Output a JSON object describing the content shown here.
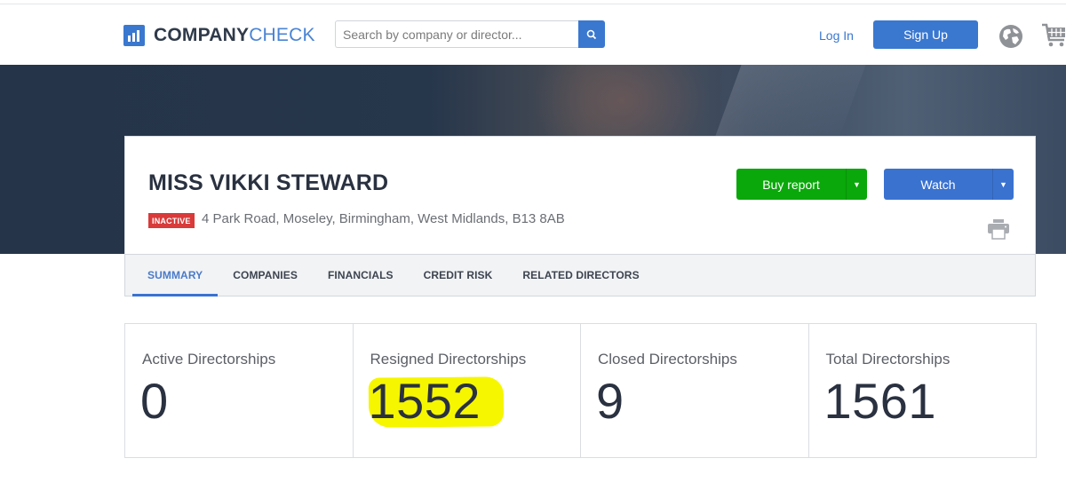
{
  "header": {
    "logo": {
      "bold": "COMPANY",
      "light": "CHECK"
    },
    "search": {
      "placeholder": "Search by company or director...",
      "value": ""
    },
    "login_label": "Log In",
    "signup_label": "Sign Up",
    "icons": {
      "search": "search-icon",
      "globe": "globe-icon",
      "cart": "cart-icon"
    }
  },
  "profile": {
    "name": "MISS VIKKI STEWARD",
    "status_badge": "INACTIVE",
    "address": "4 Park Road, Moseley, Birmingham, West Midlands, B13 8AB",
    "buy_report_label": "Buy report",
    "watch_label": "Watch",
    "caret": "▼"
  },
  "tabs": [
    {
      "label": "SUMMARY",
      "active": true
    },
    {
      "label": "COMPANIES",
      "active": false
    },
    {
      "label": "FINANCIALS",
      "active": false
    },
    {
      "label": "CREDIT RISK",
      "active": false
    },
    {
      "label": "RELATED DIRECTORS",
      "active": false
    }
  ],
  "stats": [
    {
      "label": "Active Directorships",
      "value": "0",
      "highlighted": false
    },
    {
      "label": "Resigned Directorships",
      "value": "1552",
      "highlighted": true
    },
    {
      "label": "Closed Directorships",
      "value": "9",
      "highlighted": false
    },
    {
      "label": "Total Directorships",
      "value": "1561",
      "highlighted": false
    }
  ],
  "colors": {
    "brand_blue": "#3a78d0",
    "buy_green": "#0aa80a",
    "inactive_red": "#d93a3a",
    "highlight_yellow": "#f6f600",
    "hero_dark": "#253448"
  }
}
